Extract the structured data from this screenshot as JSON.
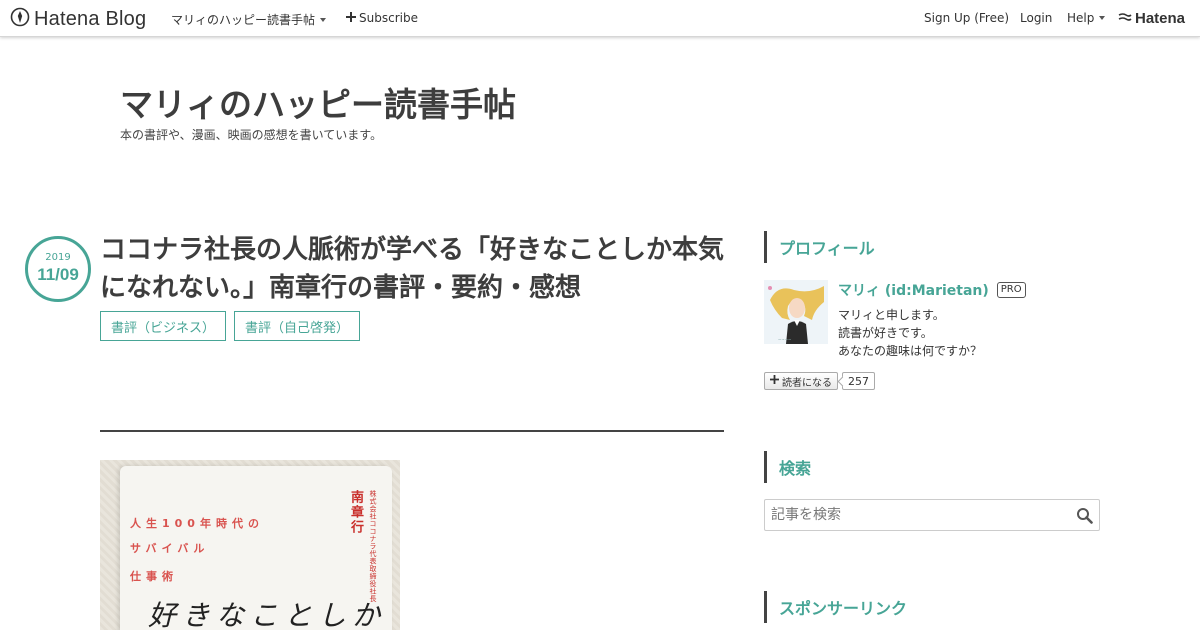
{
  "topbar": {
    "logo_text": "Hatena Blog",
    "blog_menu_label": "マリィのハッピー読書手帖",
    "subscribe_label": "Subscribe",
    "signup_label": "Sign Up (Free)",
    "login_label": "Login",
    "help_label": "Help",
    "hatena_label": "Hatena"
  },
  "blog": {
    "title": "マリィのハッピー読書手帖",
    "description": "本の書評や、漫画、映画の感想を書いています。"
  },
  "entry": {
    "date_year": "2019",
    "date_md": "11/09",
    "title": "ココナラ社長の人脈術が学べる「好きなことしか本気になれない。」南章行の書評・要約・感想",
    "categories": [
      "書評（ビジネス）",
      "書評（自己啓発）"
    ],
    "image": {
      "line1": "人生100年時代の",
      "line2": "サバイバル",
      "line3": "仕事術",
      "author": "南章行",
      "publisher": "株式会社ココナラ代表取締役社長",
      "handwritten": "好きなことしか"
    }
  },
  "sidebar": {
    "profile_heading": "プロフィール",
    "profile_name": "マリィ (id:Marietan)",
    "pro_badge": "PRO",
    "profile_lines": [
      "マリィと申します。",
      "読書が好きです。",
      "あなたの趣味は何ですか？"
    ],
    "reader_button": "読者になる",
    "reader_count": "257",
    "search_heading": "検索",
    "search_placeholder": "記事を検索",
    "sponsor_heading": "スポンサーリンク"
  },
  "colors": {
    "accent": "#47a596",
    "text": "#3d3d3d",
    "divider": "#444444"
  }
}
